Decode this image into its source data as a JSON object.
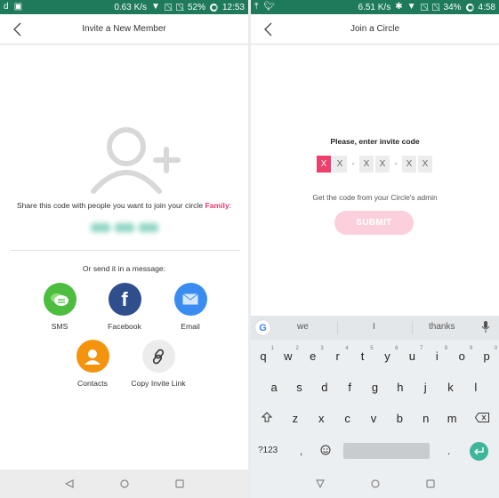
{
  "left": {
    "status": {
      "speed": "0.63 K/s",
      "battery": "52%",
      "time": "12:53"
    },
    "title": "Invite a New Member",
    "share_prefix": "Share this code with people you want to join your circle ",
    "circle_name": "Family",
    "share_suffix": ":",
    "code_hidden": true,
    "or_text": "Or send it in a message:",
    "share_options": [
      {
        "label": "SMS",
        "icon": "sms-icon",
        "color": "#4cbd3f"
      },
      {
        "label": "Facebook",
        "icon": "facebook-icon",
        "color": "#2e4e8c"
      },
      {
        "label": "Email",
        "icon": "email-icon",
        "color": "#3a8cf0"
      },
      {
        "label": "Contacts",
        "icon": "contacts-icon",
        "color": "#f4930e"
      },
      {
        "label": "Copy Invite Link",
        "icon": "link-icon",
        "color": "#ececec"
      }
    ]
  },
  "right": {
    "status": {
      "speed": "6.51 K/s",
      "battery": "34%",
      "time": "4:58"
    },
    "title": "Join a Circle",
    "prompt": "Please, enter invite code",
    "code_boxes": [
      "X",
      "X",
      "X",
      "X",
      "X",
      "X"
    ],
    "separator": "-",
    "hint": "Get the code from your Circle's admin",
    "submit_label": "SUBMIT",
    "keyboard": {
      "suggestions": [
        "we",
        "I",
        "thanks"
      ],
      "row1": [
        "q",
        "w",
        "e",
        "r",
        "t",
        "y",
        "u",
        "i",
        "o",
        "p"
      ],
      "row1_digits": [
        "1",
        "2",
        "3",
        "4",
        "5",
        "6",
        "7",
        "8",
        "9",
        "0"
      ],
      "row2": [
        "a",
        "s",
        "d",
        "f",
        "g",
        "h",
        "j",
        "k",
        "l"
      ],
      "row3": [
        "z",
        "x",
        "c",
        "v",
        "b",
        "n",
        "m"
      ],
      "symbols_label": "?123",
      "comma": ",",
      "period": "."
    }
  },
  "colors": {
    "status_bar": "#1f7a5c",
    "accent_pink": "#e8386d",
    "submit_disabled": "#fbd0dc",
    "enter_key": "#3fb59a"
  }
}
